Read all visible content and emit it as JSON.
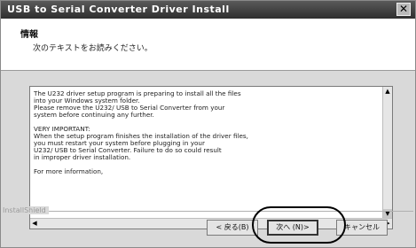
{
  "window": {
    "title": "USB to Serial Converter Driver Install",
    "close_label": "✕"
  },
  "header": {
    "heading": "情報",
    "subheading": "次のテキストをお読みください。"
  },
  "textbox": {
    "content": "The U232 driver setup program is preparing to install all the files\ninto your Windows system folder.\nPlease remove the U232/ USB to Serial Converter from your\nsystem before continuing any further.\n\nVERY IMPORTANT:\nWhen the setup program finishes the installation of the driver files,\nyou must restart your system before plugging in your\nU232/ USB to Serial Converter. Failure to do so could result\nin improper driver installation.\n\nFor more information,"
  },
  "scrollbar": {
    "up_arrow": "▲",
    "down_arrow": "▼",
    "left_arrow": "◀",
    "right_arrow": "▶"
  },
  "footer": {
    "installshield_label": "InstallShield"
  },
  "buttons": {
    "back": "< 戻る(B)",
    "next": "次へ (N)>",
    "cancel": "キャンセル"
  }
}
